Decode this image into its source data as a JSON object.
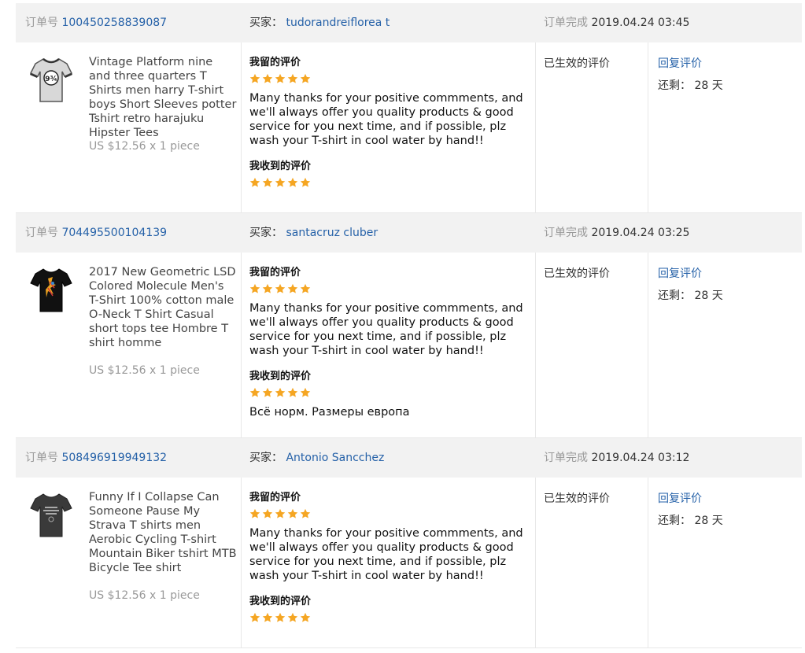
{
  "labels": {
    "order_no": "订单号",
    "buyer": "买家：",
    "completed": "订单完成",
    "left_review": "我留的评价",
    "received_review": "我收到的评价",
    "status_effective": "已生效的评价",
    "reply": "回复评价",
    "remaining": "还剩：",
    "remaining_value": "28 天"
  },
  "colors": {
    "star": "#f5a623",
    "link": "#2561a8",
    "header_bg": "#f2f2f2"
  },
  "orders": [
    {
      "order_id": "100450258839087",
      "buyer": "tudorandreiflorea t",
      "completed": "2019.04.24 03:45",
      "product_title": "Vintage Platform nine and three quarters T Shirts men harry T-shirt boys Short Sleeves potter Tshirt retro harajuku Hipster Tees",
      "price": "US $12.56 x 1 piece",
      "my_stars": 5,
      "my_review": "Many thanks for your positive commments, and we'll always offer you quality products & good service for you next time, and if possible, plz wash your T-shirt in cool water by hand!!",
      "recv_stars": 5,
      "feedback": ""
    },
    {
      "order_id": "704495500104139",
      "buyer": "santacruz cluber",
      "completed": "2019.04.24 03:25",
      "product_title": "2017 New Geometric LSD Colored Molecule Men's T-Shirt 100% cotton male O-Neck T Shirt Casual short tops tee Hombre T shirt homme",
      "price": "US $12.56 x 1 piece",
      "my_stars": 5,
      "my_review": "Many thanks for your positive commments, and we'll always offer you quality products & good service for you next time, and if possible, plz wash your T-shirt in cool water by hand!!",
      "recv_stars": 5,
      "feedback": "Всё норм. Размеры европа"
    },
    {
      "order_id": "508496919949132",
      "buyer": "Antonio Sancchez",
      "completed": "2019.04.24 03:12",
      "product_title": "Funny If I Collapse Can Someone Pause My Strava T shirts men Aerobic Cycling T-shirt Mountain Biker tshirt MTB Bicycle Tee shirt",
      "price": "US $12.56 x 1 piece",
      "my_stars": 5,
      "my_review": "Many thanks for your positive commments, and we'll always offer you quality products & good service for you next time, and if possible, plz wash your T-shirt in cool water by hand!!",
      "recv_stars": 5,
      "feedback": ""
    }
  ]
}
